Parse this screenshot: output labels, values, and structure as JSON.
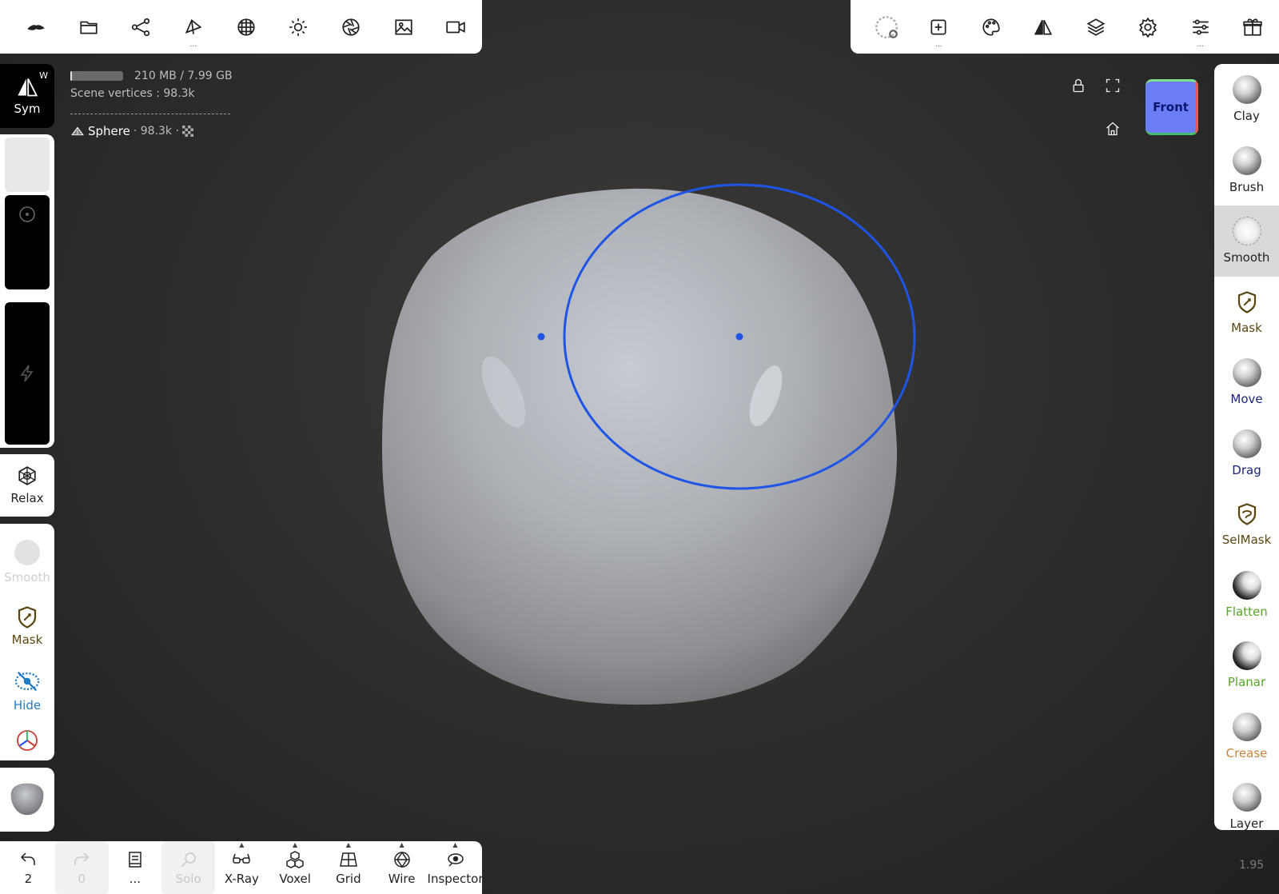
{
  "colors": {
    "accent_blue": "#1f55e6",
    "view_cube": "#6b7ef5",
    "mask_label": "#5a4610",
    "move_label": "#1a237e",
    "selmask_label": "#5a4610",
    "flatten_label": "#57a626",
    "planar_label": "#57a626",
    "crease_label": "#c9853c"
  },
  "top_left_toolbar": [
    {
      "icon": "app-logo-icon"
    },
    {
      "icon": "folder-icon"
    },
    {
      "icon": "share-icon"
    },
    {
      "icon": "topology-icon",
      "dots": true
    },
    {
      "icon": "sphere-grid-icon"
    },
    {
      "icon": "light-sun-icon"
    },
    {
      "icon": "aperture-icon"
    },
    {
      "icon": "image-icon"
    },
    {
      "icon": "video-camera-icon"
    }
  ],
  "top_right_toolbar": [
    {
      "icon": "tool-preview-icon"
    },
    {
      "icon": "stroke-settings-icon",
      "dots": true
    },
    {
      "icon": "palette-icon"
    },
    {
      "icon": "symmetry-icon"
    },
    {
      "icon": "layers-icon"
    },
    {
      "icon": "settings-gear-icon"
    },
    {
      "icon": "sliders-icon",
      "dots": true
    },
    {
      "icon": "gift-icon"
    }
  ],
  "sym": {
    "label": "Sym",
    "key": "W"
  },
  "relax": {
    "label": "Relax"
  },
  "left_tools": [
    {
      "label": "Smooth",
      "disabled": true
    },
    {
      "label": "Mask"
    },
    {
      "label": "Hide"
    }
  ],
  "info": {
    "memory": "210 MB / 7.99 GB",
    "memory_fraction": 0.026,
    "vertices": "Scene vertices : 98.3k",
    "object_name": "Sphere",
    "object_suffix": "· 98.3k ·"
  },
  "view_cube_label": "Front",
  "right_tools": [
    {
      "label": "Clay",
      "style": "ball"
    },
    {
      "label": "Brush",
      "style": "ball"
    },
    {
      "label": "Smooth",
      "style": "ball",
      "active": true
    },
    {
      "label": "Mask",
      "style": "shield"
    },
    {
      "label": "Move",
      "style": "ball"
    },
    {
      "label": "Drag",
      "style": "ball"
    },
    {
      "label": "SelMask",
      "style": "shield"
    },
    {
      "label": "Flatten",
      "style": "dark"
    },
    {
      "label": "Planar",
      "style": "dark"
    },
    {
      "label": "Crease",
      "style": "ball"
    },
    {
      "label": "Layer",
      "style": "ball"
    }
  ],
  "bottom_toolbar": [
    {
      "label": "2",
      "icon": "undo-icon"
    },
    {
      "label": "0",
      "icon": "redo-icon",
      "disabled": true
    },
    {
      "label": "...",
      "icon": "notebook-icon"
    },
    {
      "label": "Solo",
      "icon": "magnifier-icon",
      "disabled": true
    },
    {
      "label": "X-Ray",
      "icon": "glasses-icon",
      "caret": true
    },
    {
      "label": "Voxel",
      "icon": "voxel-cubes-icon",
      "caret": true
    },
    {
      "label": "Grid",
      "icon": "grid-plane-icon",
      "caret": true
    },
    {
      "label": "Wire",
      "icon": "wireframe-icon",
      "caret": true
    },
    {
      "label": "Inspector",
      "icon": "inspector-eye-icon",
      "caret": true
    }
  ],
  "version": "1.95"
}
